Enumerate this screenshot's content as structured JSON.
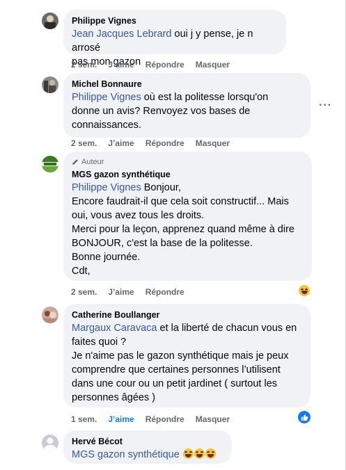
{
  "comments": [
    {
      "author": "Philippe Vignes",
      "mention": "Jean Jacques Lebrard",
      "lines": [
        " oui j y pense, je n arrosé",
        "pas mon gazon"
      ],
      "time": "2 sem.",
      "like": "J’aime",
      "reply": "Répondre",
      "hide": "Masquer"
    },
    {
      "author": "Michel Bonnaure",
      "mention": "Philippe Vignes",
      "lines": [
        " où est la politesse lorsqu'on",
        "donne un avis? Renvoyez vos bases de",
        "connaissances."
      ],
      "time": "2 sem.",
      "like": "J’aime",
      "reply": "Répondre",
      "hide": "Masquer"
    },
    {
      "badge": "Auteur",
      "author": "MGS gazon synthétique",
      "mention": "Philippe Vignes",
      "lines": [
        " Bonjour,",
        "Encore faudrait-il que cela soit constructif... Mais",
        "oui, vous avez tous les droits.",
        "Merci pour la leçon, apprenez quand même à dire",
        "BONJOUR, c'est la base de la politesse.",
        "Bonne journée.",
        "Cdt,"
      ],
      "time": "2 sem.",
      "like": "J’aime",
      "reply": "Répondre"
    },
    {
      "author": "Catherine Boullanger",
      "mention": "Margaux Caravaca",
      "lines": [
        " et la liberté de chacun vous en",
        "faites quoi ?",
        "Je n'aime pas le gazon synthétique mais je peux",
        "comprendre que certaines personnes l’utilisent",
        "dans une cour ou un petit jardinet ( surtout les",
        "personnes âgées )"
      ],
      "time": "1 sem.",
      "like": "J’aime",
      "reply": "Répondre",
      "hide": "Masquer"
    },
    {
      "author": "Hervé Bécot",
      "mention": "MGS gazon synthétique",
      "lines": [
        ""
      ]
    }
  ],
  "icons": {
    "more": "more-options-icon",
    "haha": "haha-reaction-icon",
    "like": "like-reaction-icon",
    "pencil": "pencil-icon"
  },
  "colors": {
    "mention": "#385898",
    "liked": "#1877f2",
    "bubble": "#f0f2f5",
    "meta": "#65676b"
  }
}
